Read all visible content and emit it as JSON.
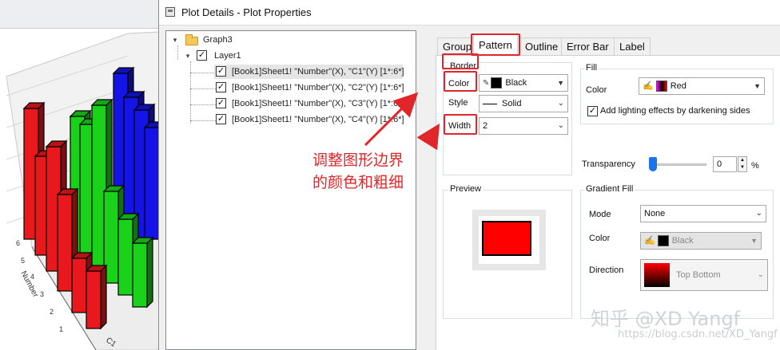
{
  "plot": {
    "axis_label_number": "Number",
    "tick_labels": [
      "6",
      "5",
      "4",
      "3",
      "2",
      "1"
    ],
    "category_label": "C1",
    "colors": {
      "red": "#e8181c",
      "green": "#19d219",
      "blue": "#1414e6"
    }
  },
  "dialog": {
    "title": "Plot Details - Plot Properties",
    "tree": {
      "root": "Graph3",
      "layer": "Layer1",
      "plots": [
        "[Book1]Sheet1! \"Number\"(X), \"C1\"(Y) [1*:6*]",
        "[Book1]Sheet1! \"Number\"(X), \"C2\"(Y) [1*:6*]",
        "[Book1]Sheet1! \"Number\"(X), \"C3\"(Y) [1*:6*]",
        "[Book1]Sheet1! \"Number\"(X), \"C4\"(Y) [1*:6*]"
      ]
    },
    "tabs": [
      "Group",
      "Pattern",
      "Outline",
      "Error Bar",
      "Label"
    ],
    "active_tab": "Pattern",
    "border": {
      "label": "Border",
      "color_label": "Color",
      "color_value": "Black",
      "style_label": "Style",
      "style_value": "Solid",
      "width_label": "Width",
      "width_value": "2"
    },
    "fill": {
      "label": "Fill",
      "color_label": "Color",
      "color_value": "Red",
      "lighting_label": "Add lighting effects by darkening sides",
      "lighting_checked": true
    },
    "transparency": {
      "label": "Transparency",
      "value": "0",
      "unit": "%",
      "fraction": 0
    },
    "preview": {
      "label": "Preview"
    },
    "gradient": {
      "label": "Gradient Fill",
      "mode_label": "Mode",
      "mode_value": "None",
      "color_label": "Color",
      "color_value": "Black",
      "direction_label": "Direction",
      "direction_value": "Top Bottom"
    },
    "colors": {
      "accent_red": "#e0262a",
      "black": "#000000",
      "fill_red": "#ff0000"
    }
  },
  "annotation": {
    "line1": "调整图形边界",
    "line2": "的颜色和粗细"
  },
  "watermark": {
    "main": "知乎 @XD Yangf",
    "url": "https://blog.csdn.net/XD_Yangf"
  }
}
